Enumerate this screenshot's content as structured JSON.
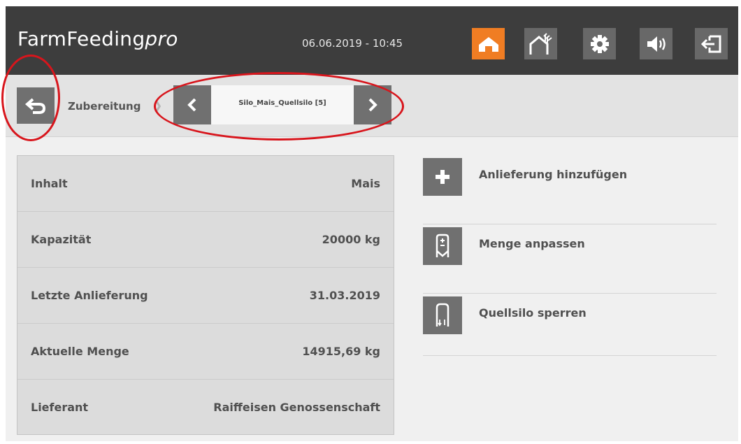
{
  "app": {
    "brand_main": "FarmFeeding",
    "brand_suffix": "pro",
    "datetime": "06.06.2019 - 10:45"
  },
  "toolbar": [
    {
      "icon": "home-icon",
      "active": true
    },
    {
      "icon": "barn-feed-icon",
      "active": false
    },
    {
      "icon": "gear-icon",
      "active": false
    },
    {
      "icon": "speaker-icon",
      "active": false
    },
    {
      "icon": "logout-icon",
      "active": false
    }
  ],
  "breadcrumb": {
    "back_icon": "back-arrow-icon",
    "parent": "Zubereitung",
    "separator": "❯",
    "current_silo": "Silo_Mais_Quellsilo [5]",
    "prev_icon": "chevron-left-icon",
    "next_icon": "chevron-right-icon"
  },
  "details": [
    {
      "label": "Inhalt",
      "value": "Mais"
    },
    {
      "label": "Kapazität",
      "value": "20000 kg"
    },
    {
      "label": "Letzte Anlieferung",
      "value": "31.03.2019"
    },
    {
      "label": "Aktuelle Menge",
      "value": "14915,69 kg"
    },
    {
      "label": "Lieferant",
      "value": "Raiffeisen Genossenschaft"
    }
  ],
  "actions": [
    {
      "label": "Anlieferung hinzufügen",
      "icon": "plus-icon"
    },
    {
      "label": "Menge anpassen",
      "icon": "silo-adjust-icon"
    },
    {
      "label": "Quellsilo sperren",
      "icon": "silo-lock-icon"
    }
  ],
  "colors": {
    "header_bg": "#3d3d3d",
    "accent": "#f07d23",
    "button_bg": "#707070",
    "annotation": "#d8151c"
  }
}
